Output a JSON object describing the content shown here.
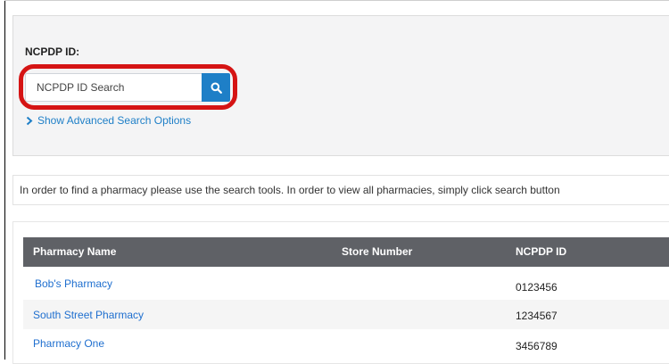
{
  "search": {
    "label": "NCPDP ID:",
    "placeholder": "NCPDP ID Search",
    "advanced_link": "Show Advanced Search Options"
  },
  "info": {
    "message": "In order to find a pharmacy please use the search tools. In order to view all pharmacies, simply click search button"
  },
  "table": {
    "headers": [
      "Pharmacy Name",
      "Store Number",
      "NCPDP ID"
    ],
    "rows": [
      {
        "name": "Bob's Pharmacy",
        "store": "",
        "ncpdp": "0123456"
      },
      {
        "name": "South Street Pharmacy",
        "store": "",
        "ncpdp": "1234567"
      },
      {
        "name": "Pharmacy One",
        "store": "",
        "ncpdp": "3456789"
      }
    ]
  },
  "colors": {
    "accent": "#1e7fc7",
    "highlight_ring": "#d51414",
    "table_header": "#5f6166",
    "link": "#1f6fcf"
  },
  "icons": {
    "search_button": "search-icon",
    "advanced_link": "chevron-right-icon"
  }
}
